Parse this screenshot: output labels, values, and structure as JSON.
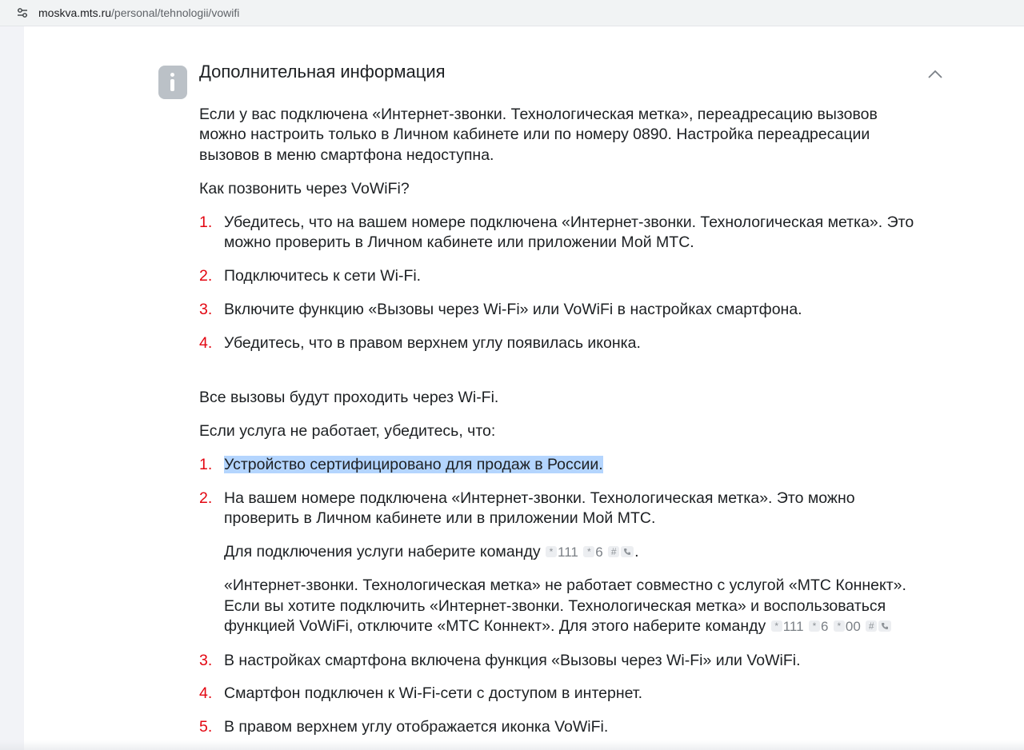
{
  "browser": {
    "url_host": "moskva.mts.ru",
    "url_path": "/personal/tehnologii/vowifi"
  },
  "section": {
    "title": "Дополнительная информация",
    "intro_lines": [
      "Если у вас подключена «Интернет-звонки. Технологическая метка», переадресацию вызовов",
      "можно настроить только в Личном кабинете или по номеру 0890. Настройка переадресации",
      "вызовов в меню смартфона недоступна."
    ],
    "how_to_call": "Как позвонить через VoWiFi?",
    "steps": [
      {
        "num": "1.",
        "lines": [
          "Убедитесь, что на вашем номере подключена «Интернет-звонки. Технологическая метка». Это",
          "можно проверить в Личном кабинете или приложении Мой МТС."
        ]
      },
      {
        "num": "2.",
        "lines": [
          "Подключитесь к сети Wi-Fi."
        ]
      },
      {
        "num": "3.",
        "lines": [
          "Включите функцию «Вызовы через Wi-Fi» или VoWiFi в настройках смартфона."
        ]
      },
      {
        "num": "4.",
        "lines": [
          "Убедитесь, что в правом верхнем углу появилась иконка."
        ]
      }
    ],
    "all_calls": "Все вызовы будут проходить через Wi-Fi.",
    "if_not_working": "Если услуга не работает, убедитесь, что:",
    "checks": [
      {
        "num": "1.",
        "lines": [
          "Устройство сертифицировано для продаж в России."
        ]
      },
      {
        "num": "2.",
        "lines": [
          "На вашем номере подключена «Интернет-звонки. Технологическая метка». Это можно",
          "проверить в Личном кабинете или в приложении Мой МТС."
        ]
      },
      {
        "num": "3.",
        "lines": [
          "В настройках смартфона включена функция «Вызовы через Wi-Fi» или VoWiFi."
        ]
      },
      {
        "num": "4.",
        "lines": [
          "Смартфон подключен к Wi-Fi-сети с доступом в интернет."
        ]
      },
      {
        "num": "5.",
        "lines": [
          "В правом верхнем углу отображается иконка VoWiFi."
        ]
      }
    ],
    "connect_text": "Для подключения услуги наберите команду",
    "connect_code": [
      "111",
      "6"
    ],
    "connect_end": ".",
    "konnekt_lines": [
      "«Интернет-звонки. Технологическая метка» не работает совместно с услугой «МТС Коннект».",
      "Если вы хотите подключить «Интернет-звонки. Технологическая метка» и воспользоваться",
      "функцией VoWiFi, отключите «МТС Коннект». Для этого наберите команду"
    ],
    "disconnect_code": [
      "111",
      "6",
      "00"
    ],
    "key_star": "*",
    "key_hash": "#"
  },
  "icons": {
    "site_settings": "tune-icon",
    "info": "info-icon",
    "collapse": "chevron-up-icon",
    "call_key": "phone-icon"
  },
  "colors": {
    "list_number": "#e30611",
    "text": "#1d2023",
    "selection": "#b4d5fe",
    "info_badge": "#bbc1c7"
  }
}
